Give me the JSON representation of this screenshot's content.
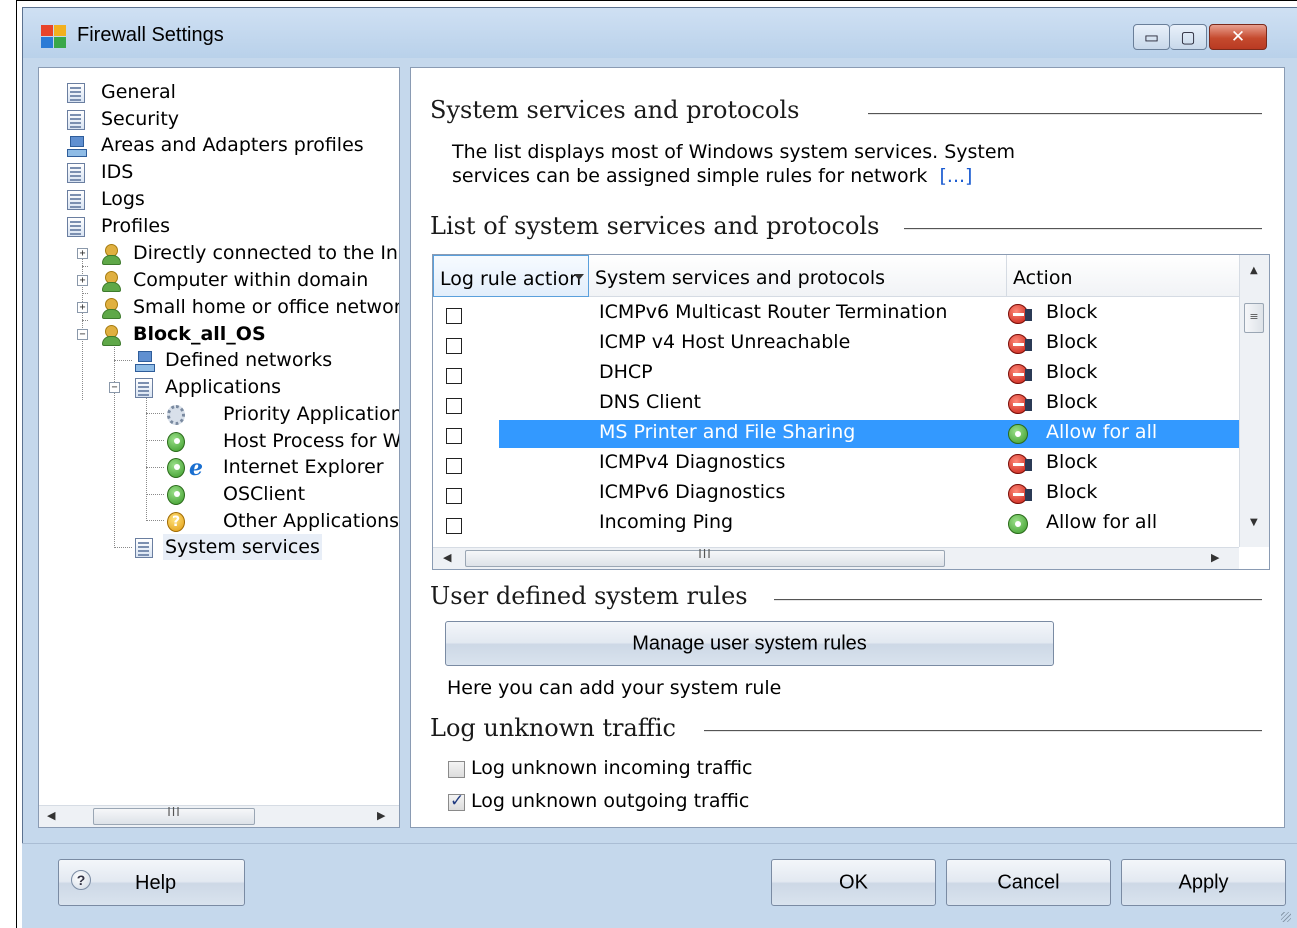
{
  "window": {
    "title": "Firewall Settings",
    "controls": {
      "minimize": "▭",
      "maximize": "▢",
      "close": "✕"
    }
  },
  "icons": {
    "app": "avg-logo-icon",
    "document": "document-icon",
    "user": "user-icon",
    "network": "network-icon",
    "gear": "gear-icon",
    "allow": "allow-icon",
    "block": "block-icon",
    "internet_explorer": "internet-explorer-icon",
    "question": "question-icon",
    "help": "help-icon"
  },
  "colors": {
    "window_bg": "#c5d8ec",
    "selection": "#3399ff",
    "link": "#1a5bd0",
    "block": "#c41a10",
    "allow": "#3a9a28"
  },
  "tree": {
    "items": [
      {
        "label": "General"
      },
      {
        "label": "Security"
      },
      {
        "label": "Areas and Adapters profiles"
      },
      {
        "label": "IDS"
      },
      {
        "label": "Logs"
      },
      {
        "label": "Profiles"
      },
      {
        "label": "Directly connected to the In"
      },
      {
        "label": "Computer within domain"
      },
      {
        "label": "Small home or office networl"
      },
      {
        "label": "Block_all_OS"
      },
      {
        "label": "Defined networks"
      },
      {
        "label": "Applications"
      },
      {
        "label": "Priority Application"
      },
      {
        "label": "Host Process for W"
      },
      {
        "label": "Internet Explorer"
      },
      {
        "label": "OSClient"
      },
      {
        "label": "Other Applications"
      },
      {
        "label": "System services"
      }
    ],
    "expanders": {
      "plus": "+",
      "minus": "−"
    },
    "scroll": {
      "left": "◀",
      "right": "▶",
      "thumb": "III"
    }
  },
  "main": {
    "header": {
      "title": "System services and protocols",
      "description_line1": "The list displays most of Windows system services. System",
      "description_line2": "services can be assigned simple rules for network",
      "more_link": "[...]"
    },
    "list": {
      "title": "List of system services and protocols",
      "columns": [
        "Log rule action",
        "System services and protocols",
        "Action"
      ],
      "rows": [
        {
          "service": "ICMPv6 Multicast Router Termination",
          "action": "Block",
          "logged": false
        },
        {
          "service": "ICMP v4 Host Unreachable",
          "action": "Block",
          "logged": false
        },
        {
          "service": "DHCP",
          "action": "Block",
          "logged": false
        },
        {
          "service": "DNS Client",
          "action": "Block",
          "logged": false
        },
        {
          "service": "MS Printer and File Sharing",
          "action": "Allow for all",
          "logged": false,
          "selected": true
        },
        {
          "service": "ICMPv4 Diagnostics",
          "action": "Block",
          "logged": false
        },
        {
          "service": "ICMPv6 Diagnostics",
          "action": "Block",
          "logged": false
        },
        {
          "service": "Incoming Ping",
          "action": "Allow for all",
          "logged": false
        }
      ],
      "scroll": {
        "up": "▲",
        "down": "▼",
        "left": "◀",
        "right": "▶",
        "thumb": "III",
        "vthumb": "≡"
      }
    },
    "user_rules": {
      "title": "User defined system rules",
      "button": "Manage user system rules",
      "hint": "Here you can add your system rule"
    },
    "log_unknown": {
      "title": "Log unknown traffic",
      "incoming": {
        "label": "Log unknown incoming traffic",
        "checked": false
      },
      "outgoing": {
        "label": "Log unknown outgoing traffic",
        "checked": true
      }
    }
  },
  "footer": {
    "help": "Help",
    "help_glyph": "?",
    "ok": "OK",
    "cancel": "Cancel",
    "apply": "Apply"
  }
}
